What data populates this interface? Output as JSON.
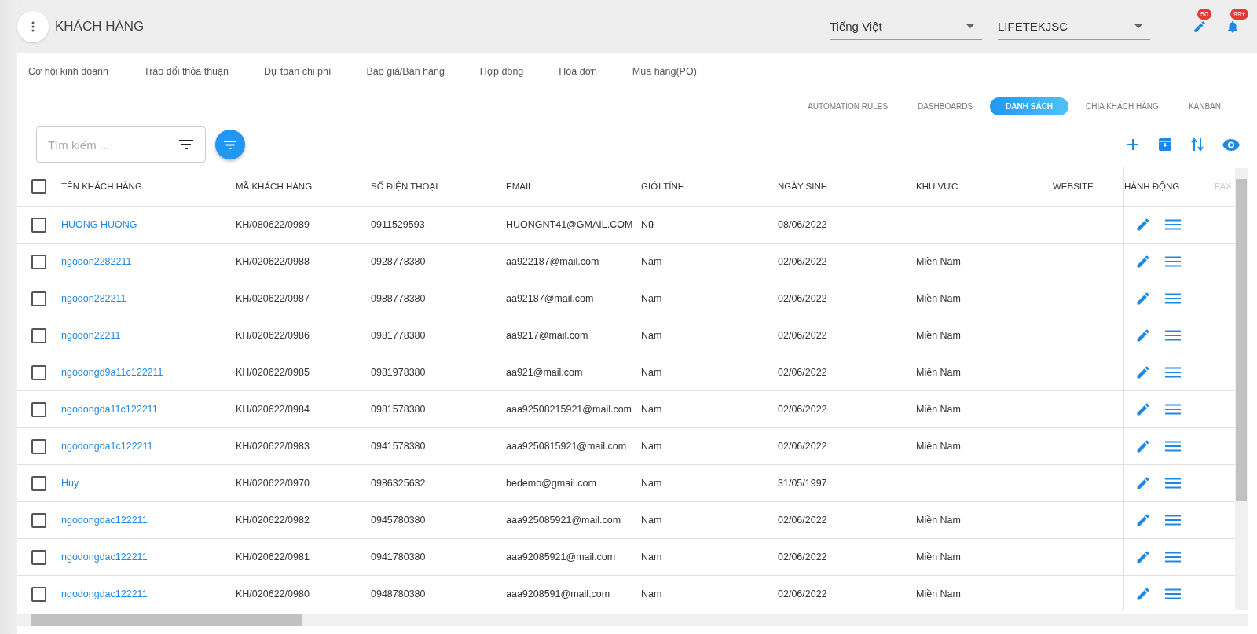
{
  "header": {
    "title": "KHÁCH HÀNG",
    "language": "Tiếng Việt",
    "company": "LIFETEKJSC",
    "badges": [
      {
        "kind": "edit",
        "count": "50"
      },
      {
        "kind": "bell",
        "count": "99+"
      }
    ]
  },
  "nav_tabs": [
    "Cơ hội kinh doanh",
    "Trao đổi thỏa thuận",
    "Dự toán chi phí",
    "Báo giá/Bán hàng",
    "Hợp đồng",
    "Hóa đơn",
    "Mua hàng(PO)"
  ],
  "view_tabs": [
    {
      "label": "AUTOMATION RULES",
      "selected": false
    },
    {
      "label": "DASHBOARDS",
      "selected": false
    },
    {
      "label": "DANH SÁCH",
      "selected": true
    },
    {
      "label": "CHIA KHÁCH HÀNG",
      "selected": false
    },
    {
      "label": "KANBAN",
      "selected": false
    }
  ],
  "search": {
    "placeholder": "Tìm kiếm ..."
  },
  "table": {
    "all_checked": false,
    "columns": [
      "TÊN KHÁCH HÀNG",
      "MÃ KHÁCH HÀNG",
      "SỐ ĐIỆN THOẠI",
      "EMAIL",
      "GIỚI TÍNH",
      "NGÀY SINH",
      "KHU VỰC",
      "WEBSITE",
      "HÀNH ĐỘNG",
      "FAX"
    ],
    "rows": [
      {
        "checked": false,
        "name": "HUONG HUONG",
        "code": "KH/080622/0989",
        "phone": "0911529593",
        "email": "HUONGNT41@GMAIL.COM",
        "gender": "Nữ",
        "birthday": "08/06/2022",
        "region": ""
      },
      {
        "checked": false,
        "name": "ngodon2282211",
        "code": "KH/020622/0988",
        "phone": "0928778380",
        "email": "aa922187@mail.com",
        "gender": "Nam",
        "birthday": "02/06/2022",
        "region": "Miền Nam"
      },
      {
        "checked": false,
        "name": "ngodon282211",
        "code": "KH/020622/0987",
        "phone": "0988778380",
        "email": "aa92187@mail.com",
        "gender": "Nam",
        "birthday": "02/06/2022",
        "region": "Miền Nam"
      },
      {
        "checked": false,
        "name": "ngodon22211",
        "code": "KH/020622/0986",
        "phone": "0981778380",
        "email": "aa9217@mail.com",
        "gender": "Nam",
        "birthday": "02/06/2022",
        "region": "Miền Nam"
      },
      {
        "checked": false,
        "name": "ngodongd9a11c122211",
        "code": "KH/020622/0985",
        "phone": "0981978380",
        "email": "aa921@mail.com",
        "gender": "Nam",
        "birthday": "02/06/2022",
        "region": "Miền Nam"
      },
      {
        "checked": false,
        "name": "ngodongda11c122211",
        "code": "KH/020622/0984",
        "phone": "0981578380",
        "email": "aaa92508215921@mail.com",
        "gender": "Nam",
        "birthday": "02/06/2022",
        "region": "Miền Nam"
      },
      {
        "checked": false,
        "name": "ngodongda1c122211",
        "code": "KH/020622/0983",
        "phone": "0941578380",
        "email": "aaa9250815921@mail.com",
        "gender": "Nam",
        "birthday": "02/06/2022",
        "region": "Miền Nam"
      },
      {
        "checked": false,
        "name": "Huy",
        "code": "KH/020622/0970",
        "phone": "0986325632",
        "email": "bedemo@gmail.com",
        "gender": "Nam",
        "birthday": "31/05/1997",
        "region": ""
      },
      {
        "checked": false,
        "name": "ngodongdac122211",
        "code": "KH/020622/0982",
        "phone": "0945780380",
        "email": "aaa925085921@mail.com",
        "gender": "Nam",
        "birthday": "02/06/2022",
        "region": "Miền Nam"
      },
      {
        "checked": false,
        "name": "ngodongdac122211",
        "code": "KH/020622/0981",
        "phone": "0941780380",
        "email": "aaa92085921@mail.com",
        "gender": "Nam",
        "birthday": "02/06/2022",
        "region": "Miền Nam"
      },
      {
        "checked": false,
        "name": "ngodongdac122211",
        "code": "KH/020622/0980",
        "phone": "0948780380",
        "email": "aaa9208591@mail.com",
        "gender": "Nam",
        "birthday": "02/06/2022",
        "region": "Miền Nam"
      }
    ]
  }
}
